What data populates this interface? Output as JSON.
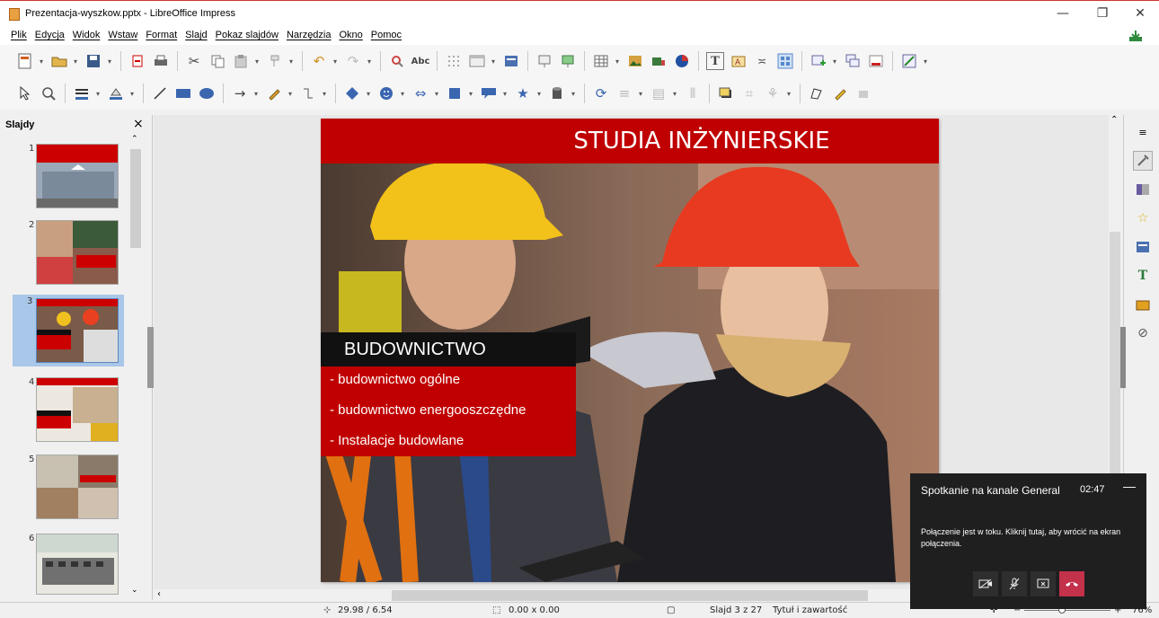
{
  "window": {
    "title": "Prezentacja-wyszkow.pptx - LibreOffice Impress",
    "controls": {
      "minimize": "—",
      "restore": "❐",
      "close": "✕"
    }
  },
  "menu": [
    "Plik",
    "Edycja",
    "Widok",
    "Wstaw",
    "Format",
    "Slajd",
    "Pokaz slajdów",
    "Narzędzia",
    "Okno",
    "Pomoc"
  ],
  "slides_panel": {
    "title": "Slajdy",
    "close": "×",
    "thumbnails": [
      {
        "num": "1"
      },
      {
        "num": "2"
      },
      {
        "num": "3",
        "selected": true
      },
      {
        "num": "4"
      },
      {
        "num": "5"
      },
      {
        "num": "6"
      }
    ]
  },
  "slide": {
    "header": "STUDIA INŻYNIERSKIE",
    "box_title": "BUDOWNICTWO",
    "bullets": [
      "- budownictwo ogólne",
      "- budownictwo energooszczędne",
      "- Instalacje budowlane"
    ]
  },
  "statusbar": {
    "position": "29.98 / 6.54",
    "size": "0.00 x 0.00",
    "slide": "Slajd 3 z 27",
    "layout": "Tytuł i zawartość",
    "zoom": "76%"
  },
  "teams": {
    "title": "Spotkanie na kanale General",
    "time": "02:47",
    "minimize": "—",
    "message": "Połączenie jest w toku. Kliknij tutaj, aby wrócić na ekran połączenia.",
    "buttons": [
      "camera-off",
      "mic-off",
      "share-stop",
      "hang-up"
    ]
  },
  "colors": {
    "accent": "#c00000",
    "teams_bg": "#1f1f1f",
    "hangup": "#c4314b"
  }
}
